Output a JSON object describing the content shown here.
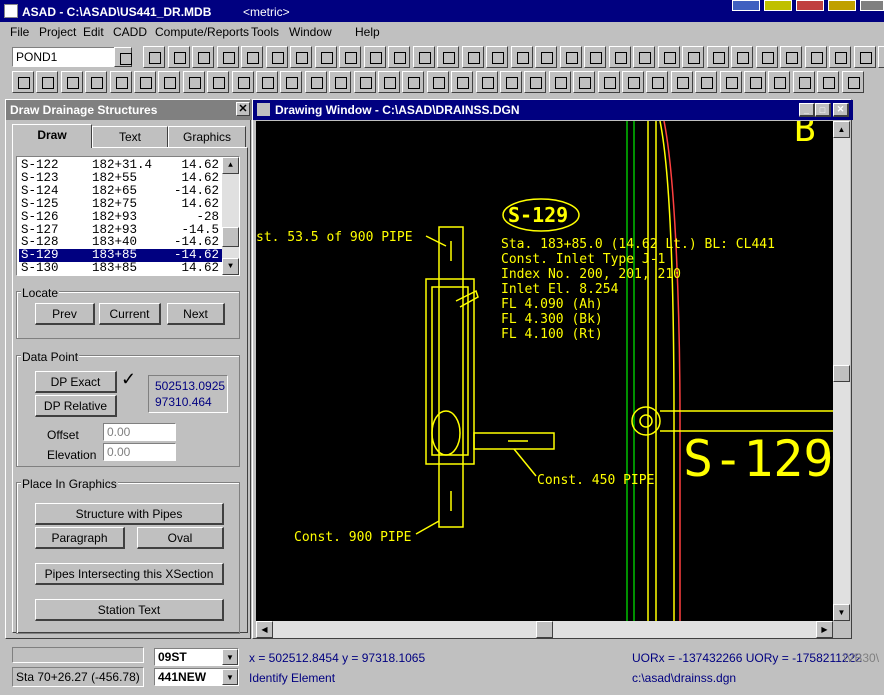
{
  "app": {
    "title": "ASAD - C:\\ASAD\\US441_DR.MDB",
    "units": "<metric>"
  },
  "menu": [
    "File",
    "Project",
    "Edit",
    "CADD",
    "Compute/Reports",
    "Tools",
    "Window",
    "Help"
  ],
  "toolbar": {
    "pond_combo": "POND1"
  },
  "panel": {
    "title": "Draw Drainage Structures",
    "tabs": [
      "Draw",
      "Text",
      "Graphics"
    ],
    "structures": [
      {
        "id": "S-122",
        "station": "182+31.4",
        "offset": "14.62"
      },
      {
        "id": "S-123",
        "station": "182+55",
        "offset": "14.62"
      },
      {
        "id": "S-124",
        "station": "182+65",
        "offset": "-14.62"
      },
      {
        "id": "S-125",
        "station": "182+75",
        "offset": "14.62"
      },
      {
        "id": "S-126",
        "station": "182+93",
        "offset": "-28"
      },
      {
        "id": "S-127",
        "station": "182+93",
        "offset": "-14.5"
      },
      {
        "id": "S-128",
        "station": "183+40",
        "offset": "-14.62"
      },
      {
        "id": "S-129",
        "station": "183+85",
        "offset": "-14.62"
      },
      {
        "id": "S-130",
        "station": "183+85",
        "offset": "14.62"
      }
    ],
    "selected_index": 7,
    "locate": {
      "label": "Locate",
      "prev": "Prev",
      "current": "Current",
      "next": "Next"
    },
    "datapoint": {
      "label": "Data Point",
      "exact": "DP Exact",
      "relative": "DP Relative",
      "check": "✓",
      "x": "502513.0925",
      "y": "97310.464",
      "offset_label": "Offset",
      "offset_value": "0.00",
      "elevation_label": "Elevation",
      "elevation_value": "0.00"
    },
    "place": {
      "label": "Place In Graphics",
      "structure_with_pipes": "Structure with Pipes",
      "paragraph": "Paragraph",
      "oval": "Oval",
      "pipes_intersecting": "Pipes Intersecting this XSection",
      "station_text": "Station Text"
    }
  },
  "drawing": {
    "title": "Drawing Window - C:\\ASAD\\DRAINSS.DGN",
    "label_id": "S-129",
    "notes": [
      "Sta. 183+85.0 (14.62 Lt.) BL: CL441",
      "Const. Inlet Type J-1",
      "Index No. 200, 201, 210",
      "Inlet El. 8.254",
      "FL  4.090  (Ah)",
      "FL  4.300  (Bk)",
      "FL  4.100  (Rt)"
    ],
    "callout_top": "st. 53.5 of 900 PIPE",
    "callout_450": "Const. 450 PIPE",
    "callout_900": "Const. 900 PIPE",
    "big_label": "S-129",
    "corner_text": "B"
  },
  "status": {
    "station": "Sta 70+26.27 (-456.78)",
    "combo1": "09ST",
    "combo2": "441NEW",
    "coords": "x = 502512.8454 y = 97318.1065",
    "uor": "UORx = -137432266  UORy = -1758211222",
    "vb": "\\VB30\\",
    "prompt": "Identify Element",
    "file": "c:\\asad\\drainss.dgn"
  },
  "colors": {
    "cad_yellow": "#ffff00",
    "cad_green": "#00c000",
    "cad_red": "#ff0000",
    "selection": "#000080",
    "link_blue": "#000080"
  }
}
